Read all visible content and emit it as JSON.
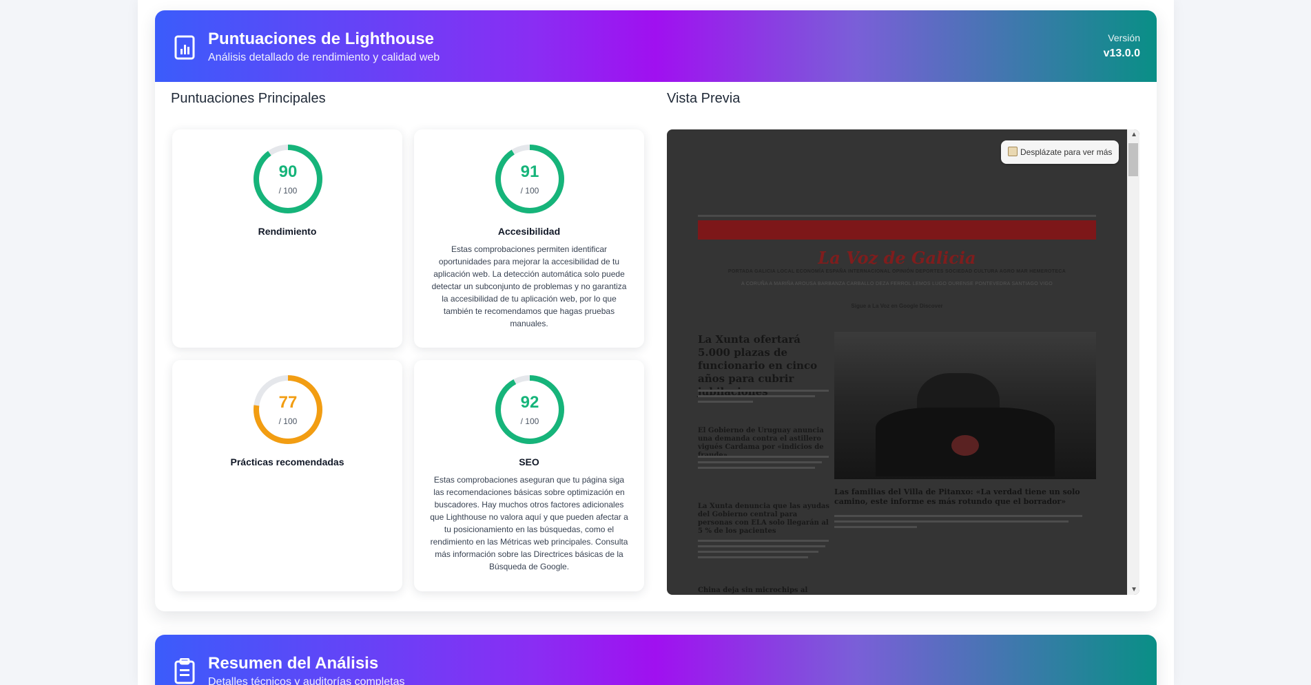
{
  "header": {
    "title": "Puntuaciones de Lighthouse",
    "subtitle": "Análisis detallado de rendimiento y calidad web",
    "version_label": "Versión",
    "version_value": "v13.0.0"
  },
  "main_scores": {
    "heading": "Puntuaciones Principales",
    "items": [
      {
        "score": "90",
        "score_value": 90,
        "out_of": "/ 100",
        "label": "Rendimiento",
        "description": "",
        "color": "#16b47a"
      },
      {
        "score": "91",
        "score_value": 91,
        "out_of": "/ 100",
        "label": "Accesibilidad",
        "description": "Estas comprobaciones permiten identificar oportunidades para mejorar la accesibilidad de tu aplicación web. La detección automática solo puede detectar un subconjunto de problemas y no garantiza la accesibilidad de tu aplicación web, por lo que también te recomendamos que hagas pruebas manuales.",
        "color": "#16b47a"
      },
      {
        "score": "77",
        "score_value": 77,
        "out_of": "/ 100",
        "label": "Prácticas recomendadas",
        "description": "",
        "color": "#f29d12"
      },
      {
        "score": "92",
        "score_value": 92,
        "out_of": "/ 100",
        "label": "SEO",
        "description": "Estas comprobaciones aseguran que tu página siga las recomendaciones básicas sobre optimización en buscadores. Hay muchos otros factores adicionales que Lighthouse no valora aquí y que pueden afectar a tu posicionamiento en las búsquedas, como el rendimiento en las Métricas web principales. Consulta más información sobre las Directrices básicas de la Búsqueda de Google.",
        "color": "#16b47a"
      }
    ]
  },
  "preview": {
    "heading": "Vista Previa",
    "scroll_hint": "Desplázate para ver más",
    "scroll_icon": "scroll-icon",
    "site": {
      "masthead": "La Voz de Galicia",
      "nav": "PORTADA  GALICIA  LOCAL  ECONOMÍA  ESPAÑA  INTERNACIONAL  OPINIÓN  DEPORTES  SOCIEDAD  CULTURA  AGRO  MAR  HEMEROTECA",
      "subnav": "A CORUÑA  A MARIÑA  AROUSA  BARBANZA  CARBALLO  DEZA  FERROL  LEMOS  LUGO  OURENSE  PONTEVEDRA  SANTIAGO  VIGO",
      "discover": "Sigue a La Voz en Google Discover",
      "headline_main": "La Xunta ofertará 5.000 plazas de funcionario en cinco años para cubrir jubilaciones",
      "headline_2": "El Gobierno de Uruguay anuncia una demanda contra el astillero vigués Cardama por «indicios de fraude»",
      "headline_3": "La Xunta denuncia que las ayudas del Gobierno central para personas con ELA solo llegarán al 5 % de los pacientes",
      "headline_4": "China deja sin microchips al motor",
      "photo_caption": "Las familias del Villa de Pitanxo: «La verdad tiene un solo camino, este informe es más rotundo que el borrador»"
    }
  },
  "summary": {
    "title": "Resumen del Análisis",
    "subtitle": "Detalles técnicos y auditorías completas"
  },
  "colors": {
    "good": "#16b47a",
    "average": "#f29d12",
    "track": "#e5e7eb"
  }
}
